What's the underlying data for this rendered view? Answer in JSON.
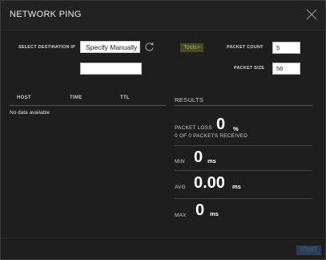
{
  "dialog": {
    "title": "NETWORK PING"
  },
  "form": {
    "select_destination_label": "SELECT DESTINATION IP",
    "destination_selected": "Specify Manually",
    "ip_value": "",
    "tools_label": "Tools>",
    "packet_count_label": "PACKET COUNT",
    "packet_count_value": "5",
    "packet_size_label": "PACKET SIZE",
    "packet_size_value": "56"
  },
  "table": {
    "columns": [
      "HOST",
      "TIME",
      "TTL"
    ],
    "empty_text": "No data available"
  },
  "results": {
    "header": "RESULTS",
    "packet_loss_label": "PACKET LOSS",
    "packet_loss_value": "0",
    "packet_loss_unit": "%",
    "received_text": "0  OF  0 PACKETS RECEIVED",
    "min_label": "MIN",
    "min_value": "0",
    "min_unit": "ms",
    "avg_label": "AVG",
    "avg_value": "0.00",
    "avg_unit": "ms",
    "max_label": "MAX",
    "max_value": "0",
    "max_unit": "ms"
  },
  "footer": {
    "start_label": "START"
  },
  "colors": {
    "background": "#1e1e1e",
    "start_button_bg": "#2a3d55",
    "tools_button_bg": "#4a4a25"
  }
}
